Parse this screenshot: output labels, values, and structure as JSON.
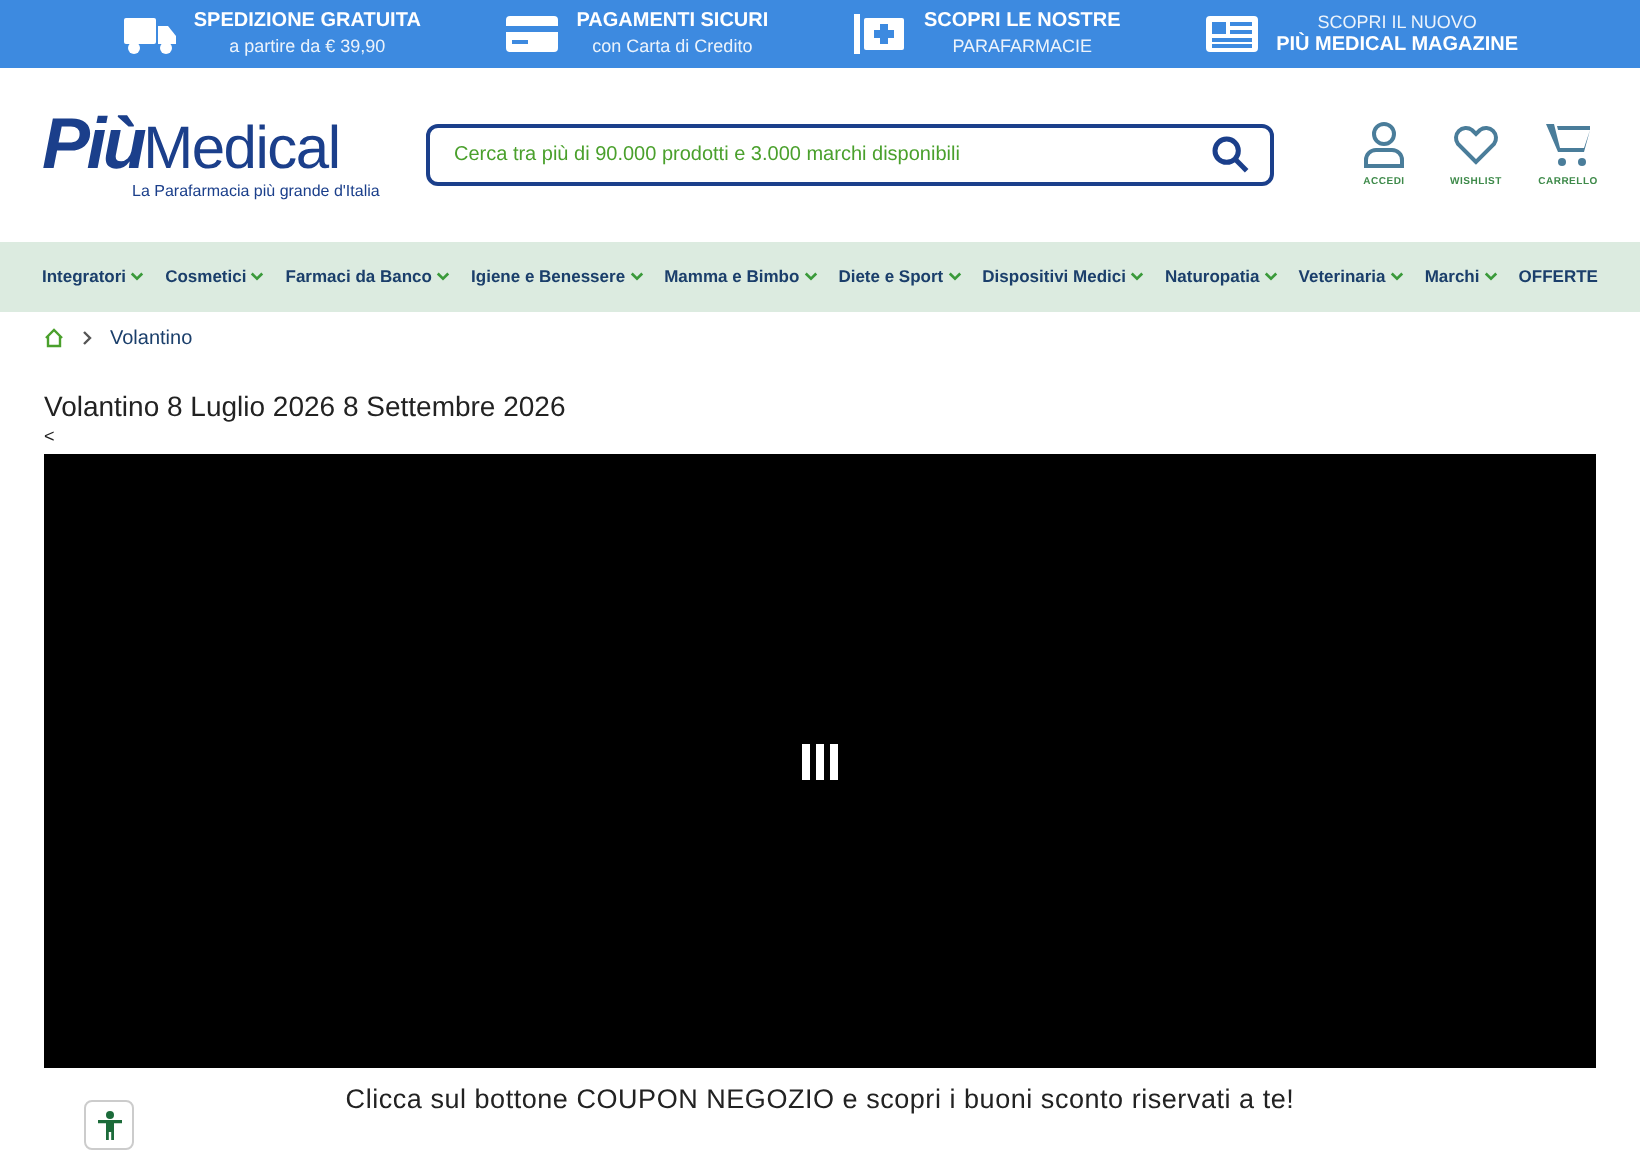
{
  "promo_bar": [
    {
      "kind": "truck",
      "lines": [
        {
          "text": "SPEDIZIONE GRATUITA",
          "kind": "title"
        },
        {
          "text": "a partire da € 39,90",
          "kind": "subtitle"
        }
      ]
    },
    {
      "kind": "card",
      "lines": [
        {
          "text": "PAGAMENTI SICURI",
          "kind": "title"
        },
        {
          "text": "con Carta di Credito",
          "kind": "subtitle"
        }
      ]
    },
    {
      "kind": "pharmacy",
      "lines": [
        {
          "text": "SCOPRI LE NOSTRE",
          "kind": "title"
        },
        {
          "text": "PARAFARMACIE",
          "kind": "subtitle"
        }
      ]
    },
    {
      "kind": "magazine",
      "lines": [
        {
          "text": "SCOPRI IL NUOVO",
          "kind": "subtitle"
        },
        {
          "text": "PIÙ MEDICAL MAGAZINE",
          "kind": "title"
        }
      ]
    }
  ],
  "logo": {
    "brand_a": "Più",
    "brand_b": "Medical",
    "tagline": "La Parafarmacia più grande d'Italia"
  },
  "search": {
    "placeholder": "Cerca tra più di 90.000 prodotti e 3.000 marchi disponibili"
  },
  "header_actions": [
    {
      "label": "ACCEDI",
      "kind": "user"
    },
    {
      "label": "WISHLIST",
      "kind": "heart"
    },
    {
      "label": "CARRELLO",
      "kind": "cart"
    }
  ],
  "nav": [
    {
      "label": "Integratori",
      "dropdown": true
    },
    {
      "label": "Cosmetici",
      "dropdown": true
    },
    {
      "label": "Farmaci da Banco",
      "dropdown": true
    },
    {
      "label": "Igiene e Benessere",
      "dropdown": true
    },
    {
      "label": "Mamma e Bimbo",
      "dropdown": true
    },
    {
      "label": "Diete e Sport",
      "dropdown": true
    },
    {
      "label": "Dispositivi Medici",
      "dropdown": true
    },
    {
      "label": "Naturopatia",
      "dropdown": true
    },
    {
      "label": "Veterinaria",
      "dropdown": true
    },
    {
      "label": "Marchi",
      "dropdown": true
    },
    {
      "label": "OFFERTE",
      "dropdown": false
    }
  ],
  "breadcrumb": [
    "Volantino"
  ],
  "page_title": "Volantino 8 Luglio 2026 8 Settembre 2026",
  "prev_link": "<",
  "coupon_banner": "Clicca sul bottone COUPON NEGOZIO e scopri i buoni sconto riservati a te!"
}
